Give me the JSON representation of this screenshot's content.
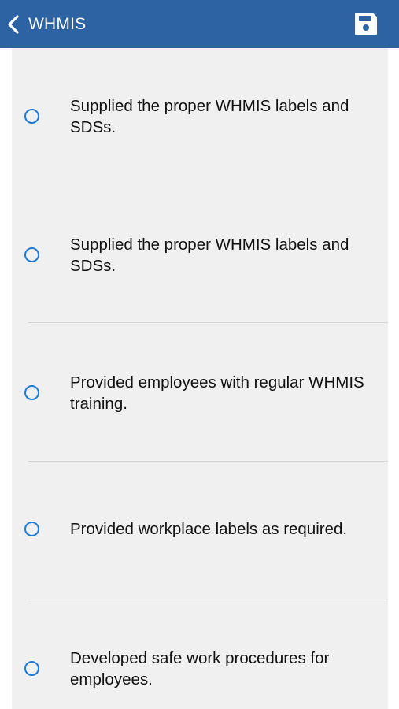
{
  "header": {
    "title": "WHMIS",
    "back_icon": "chevron-left-icon",
    "save_icon": "floppy-disk-icon",
    "background_color": "#2e63a3"
  },
  "options": [
    {
      "label": "Supplied the proper WHMIS labels and SDSs.",
      "selected": false
    },
    {
      "label": "Supplied the proper WHMIS labels and SDSs.",
      "selected": false
    },
    {
      "label": "Provided employees with regular WHMIS training.",
      "selected": false
    },
    {
      "label": "Provided workplace labels as required.",
      "selected": false
    },
    {
      "label": "Developed safe work procedures for employees.",
      "selected": false
    }
  ],
  "colors": {
    "radio_border": "#1e7bd6",
    "content_background": "#f0f0f0"
  }
}
